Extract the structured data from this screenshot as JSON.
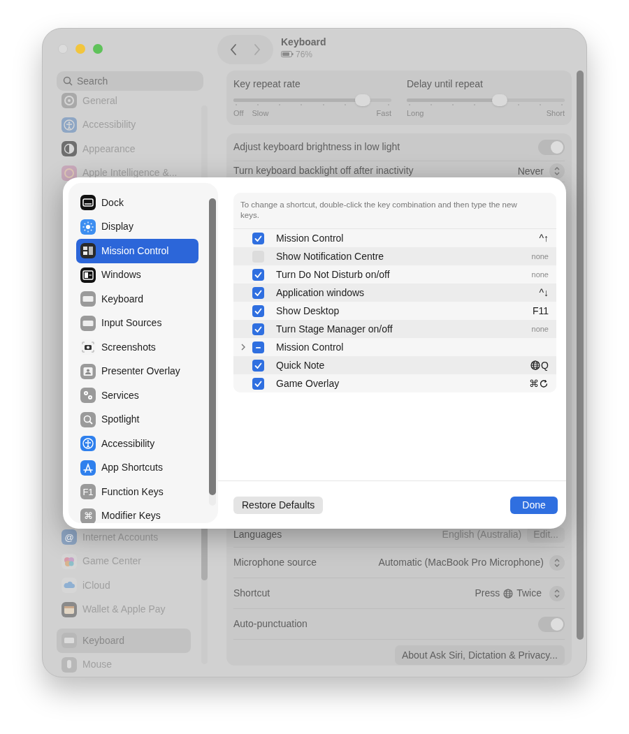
{
  "window": {
    "title": "Keyboard",
    "battery": "76%"
  },
  "sidebar": {
    "search": {
      "placeholder": "Search"
    },
    "items_top": [
      {
        "label": "General",
        "selected": false
      },
      {
        "label": "Accessibility",
        "selected": false
      },
      {
        "label": "Appearance",
        "selected": false
      },
      {
        "label": "Apple Intelligence &...",
        "selected": false
      }
    ],
    "items_bottom": [
      {
        "label": "Internet Accounts",
        "selected": false,
        "icon_text": "@"
      },
      {
        "label": "Game Center",
        "selected": false
      },
      {
        "label": "iCloud",
        "selected": false
      },
      {
        "label": "Wallet & Apple Pay",
        "selected": false
      }
    ],
    "items_section": [
      {
        "label": "Keyboard",
        "selected": true
      },
      {
        "label": "Mouse",
        "selected": false
      }
    ]
  },
  "sliders": [
    {
      "label": "Key repeat rate",
      "level": 0.82,
      "left_labels": [
        "Off",
        "Slow"
      ],
      "right_label": "Fast"
    },
    {
      "label": "Delay until repeat",
      "level": 0.59,
      "left_labels": [
        "Long"
      ],
      "right_label": "Short"
    }
  ],
  "settings_top": [
    {
      "kind": "toggle",
      "label": "Adjust keyboard brightness in low light",
      "on": true
    },
    {
      "kind": "select",
      "label": "Turn keyboard backlight off after inactivity",
      "value": "Never"
    }
  ],
  "settings_bottom": [
    {
      "kind": "edit",
      "label": "Languages",
      "value": "English (Australia)",
      "button": "Edit..."
    },
    {
      "kind": "select",
      "label": "Microphone source",
      "value": "Automatic (MacBook Pro Microphone)"
    },
    {
      "kind": "select_globe",
      "label": "Shortcut",
      "value": "Press",
      "value_suffix": "Twice"
    },
    {
      "kind": "toggle",
      "label": "Auto-punctuation",
      "on": true
    }
  ],
  "about_button": "About Ask Siri, Dictation & Privacy...",
  "sheet": {
    "categories": [
      {
        "label": "Dock",
        "selected": false
      },
      {
        "label": "Display",
        "selected": false
      },
      {
        "label": "Mission Control",
        "selected": true
      },
      {
        "label": "Windows",
        "selected": false
      },
      {
        "label": "Keyboard",
        "selected": false
      },
      {
        "label": "Input Sources",
        "selected": false
      },
      {
        "label": "Screenshots",
        "selected": false
      },
      {
        "label": "Presenter Overlay",
        "selected": false
      },
      {
        "label": "Services",
        "selected": false
      },
      {
        "label": "Spotlight",
        "selected": false
      },
      {
        "label": "Accessibility",
        "selected": false
      },
      {
        "label": "App Shortcuts",
        "selected": false
      },
      {
        "label": "Function Keys",
        "selected": false,
        "icon_text": "F1"
      },
      {
        "label": "Modifier Keys",
        "selected": false,
        "icon_text": "⌘"
      }
    ],
    "hint": "To change a shortcut, double-click the key combination and then type the new keys.",
    "shortcuts": [
      {
        "kind": "item",
        "label": "Mission Control",
        "checked": true,
        "shortcut": "^↑",
        "assigned": true
      },
      {
        "kind": "item",
        "label": "Show Notification Centre",
        "checked": false,
        "shortcut": "none",
        "assigned": false
      },
      {
        "kind": "item",
        "label": "Turn Do Not Disturb on/off",
        "checked": true,
        "shortcut": "none",
        "assigned": false
      },
      {
        "kind": "item",
        "label": "Application windows",
        "checked": true,
        "shortcut": "^↓",
        "assigned": true
      },
      {
        "kind": "item",
        "label": "Show Desktop",
        "checked": true,
        "shortcut": "F11",
        "assigned": true
      },
      {
        "kind": "item",
        "label": "Turn Stage Manager on/off",
        "checked": true,
        "shortcut": "none",
        "assigned": false
      },
      {
        "kind": "group",
        "label": "Mission Control",
        "mixed": true,
        "expanded": false
      },
      {
        "kind": "item",
        "label": "Quick Note",
        "checked": true,
        "shortcut": "Q",
        "assigned": true,
        "globe_prefix": true
      },
      {
        "kind": "item",
        "label": "Game Overlay",
        "checked": true,
        "shortcut": "⌘",
        "assigned": true,
        "reload_suffix": true
      }
    ],
    "restore_button": "Restore Defaults",
    "done_button": "Done"
  }
}
